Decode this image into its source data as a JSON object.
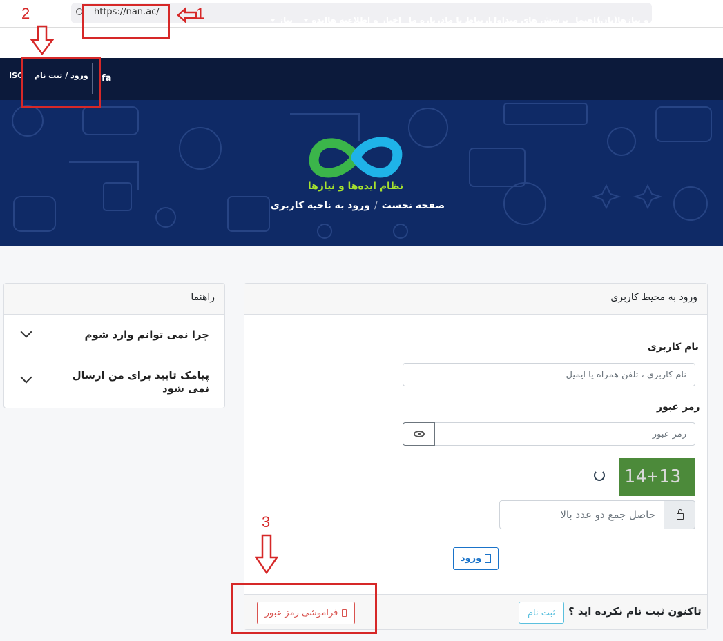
{
  "browser": {
    "url": "https://nan.ac/"
  },
  "navbar": {
    "items": [
      {
        "label": "نظام ایده ها و نیازها(نان)"
      },
      {
        "label": "راهنما"
      },
      {
        "label": "پرسش های متداول"
      },
      {
        "label": "ارتباط با ما"
      },
      {
        "label": "درباره ما"
      },
      {
        "label": "اخبار و اطلاعیه ها"
      },
      {
        "label": "ایده"
      },
      {
        "label": "نیاز"
      }
    ],
    "lang": "fa",
    "login_label": "ورود / ثبت نام",
    "isc": "ISC"
  },
  "hero": {
    "logo_text": "نظام ایده‌ها و نیازها",
    "breadcrumb_home": "صفحه نخست",
    "breadcrumb_sep": "/",
    "breadcrumb_current": "ورود به ناحیه کاربری"
  },
  "help": {
    "title": "راهنما",
    "items": [
      {
        "label": "چرا نمی توانم وارد شوم"
      },
      {
        "label": "پیامک تایید برای من ارسال نمی شود"
      }
    ]
  },
  "login": {
    "title": "ورود به محیط کاربری",
    "username_label": "نام کاربری",
    "username_placeholder": "نام کاربری ، تلفن همراه یا ایمیل",
    "password_label": "رمز عبور",
    "password_placeholder": "رمز عبور",
    "captcha_text": "14+13",
    "captcha_placeholder": "حاصل جمع دو عدد بالا",
    "submit_label": "ورود",
    "footer_text": "تاکنون ثبت نام نکرده اید ؟",
    "signup_label": "ثبت نام",
    "forgot_label": "فراموشی رمز عبور"
  },
  "annotations": {
    "one": "1",
    "two": "2",
    "three": "3"
  },
  "colors": {
    "navbar": "#0c1a3b",
    "hero": "#0f2a66",
    "annotation": "#d62828",
    "primary": "#1a73c9",
    "info": "#5bc0de",
    "danger": "#d9534f"
  }
}
